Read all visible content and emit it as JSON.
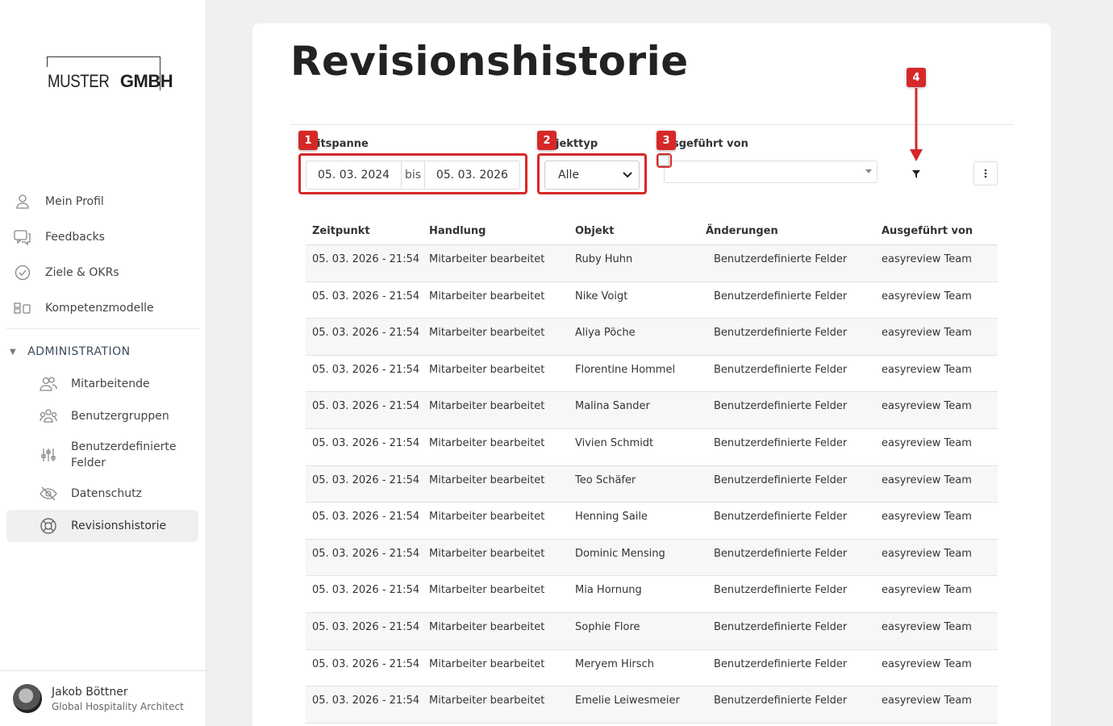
{
  "sidebar": {
    "logo": {
      "thin": "MUSTER",
      "bold": "GMBH"
    },
    "items": [
      {
        "label": "Mein Profil",
        "icon": "user-icon"
      },
      {
        "label": "Feedbacks",
        "icon": "chat-icon"
      },
      {
        "label": "Ziele & OKRs",
        "icon": "check-circle-icon"
      },
      {
        "label": "Kompetenzmodelle",
        "icon": "blocks-icon"
      }
    ],
    "admin_heading": "ADMINISTRATION",
    "admin_items": [
      {
        "label": "Mitarbeitende",
        "icon": "users-icon"
      },
      {
        "label": "Benutzergruppen",
        "icon": "group-icon"
      },
      {
        "label": "Benutzerdefinierte Felder",
        "icon": "sliders-icon"
      },
      {
        "label": "Datenschutz",
        "icon": "eye-off-icon"
      },
      {
        "label": "Revisionshistorie",
        "icon": "lifebuoy-icon"
      }
    ],
    "user": {
      "name": "Jakob Böttner",
      "role": "Global Hospitality Architect"
    }
  },
  "main": {
    "title": "Revisionshistorie",
    "filters": {
      "zeitspanne_label": "itspanne",
      "date_from": "05. 03. 2024",
      "date_sep": "bis",
      "date_to": "05. 03. 2026",
      "objekttyp_label": "jekttyp",
      "objekttyp_value": "Alle",
      "ausgefuehrt_label": "sgeführt von"
    },
    "annotations": [
      "1",
      "2",
      "3",
      "4"
    ],
    "table": {
      "headers": [
        "Zeitpunkt",
        "Handlung",
        "Objekt",
        "Änderungen",
        "Ausgeführt von"
      ],
      "rows": [
        [
          "05. 03. 2026 - 21:54",
          "Mitarbeiter bearbeitet",
          "Ruby Huhn",
          "Benutzerdefinierte Felder",
          "easyreview Team"
        ],
        [
          "05. 03. 2026 - 21:54",
          "Mitarbeiter bearbeitet",
          "Nike Voigt",
          "Benutzerdefinierte Felder",
          "easyreview Team"
        ],
        [
          "05. 03. 2026 - 21:54",
          "Mitarbeiter bearbeitet",
          "Aliya Pöche",
          "Benutzerdefinierte Felder",
          "easyreview Team"
        ],
        [
          "05. 03. 2026 - 21:54",
          "Mitarbeiter bearbeitet",
          "Florentine Hommel",
          "Benutzerdefinierte Felder",
          "easyreview Team"
        ],
        [
          "05. 03. 2026 - 21:54",
          "Mitarbeiter bearbeitet",
          "Malina Sander",
          "Benutzerdefinierte Felder",
          "easyreview Team"
        ],
        [
          "05. 03. 2026 - 21:54",
          "Mitarbeiter bearbeitet",
          "Vivien Schmidt",
          "Benutzerdefinierte Felder",
          "easyreview Team"
        ],
        [
          "05. 03. 2026 - 21:54",
          "Mitarbeiter bearbeitet",
          "Teo Schäfer",
          "Benutzerdefinierte Felder",
          "easyreview Team"
        ],
        [
          "05. 03. 2026 - 21:54",
          "Mitarbeiter bearbeitet",
          "Henning Saile",
          "Benutzerdefinierte Felder",
          "easyreview Team"
        ],
        [
          "05. 03. 2026 - 21:54",
          "Mitarbeiter bearbeitet",
          "Dominic Mensing",
          "Benutzerdefinierte Felder",
          "easyreview Team"
        ],
        [
          "05. 03. 2026 - 21:54",
          "Mitarbeiter bearbeitet",
          "Mia Hornung",
          "Benutzerdefinierte Felder",
          "easyreview Team"
        ],
        [
          "05. 03. 2026 - 21:54",
          "Mitarbeiter bearbeitet",
          "Sophie Flore",
          "Benutzerdefinierte Felder",
          "easyreview Team"
        ],
        [
          "05. 03. 2026 - 21:54",
          "Mitarbeiter bearbeitet",
          "Meryem Hirsch",
          "Benutzerdefinierte Felder",
          "easyreview Team"
        ],
        [
          "05. 03. 2026 - 21:54",
          "Mitarbeiter bearbeitet",
          "Emelie Leiwesmeier",
          "Benutzerdefinierte Felder",
          "easyreview Team"
        ]
      ]
    }
  },
  "colors": {
    "annotation": "#d62828",
    "active_bg": "#f0f0f0"
  }
}
